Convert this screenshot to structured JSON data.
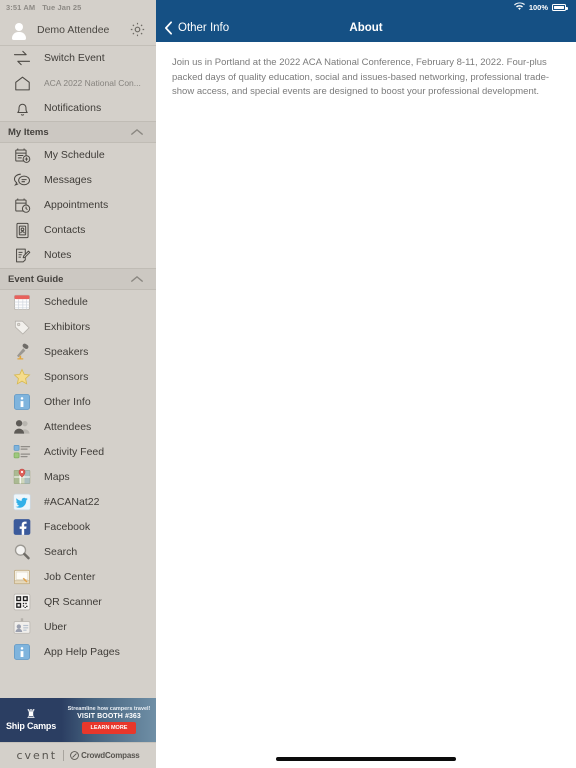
{
  "status_bar": {
    "time": "3:51 AM",
    "date": "Tue Jan 25",
    "battery_percent": "100%",
    "wifi_icon": "wifi-icon",
    "battery_icon": "battery-full-icon"
  },
  "sidebar": {
    "profile": {
      "name": "Demo Attendee",
      "avatar_icon": "person-avatar-icon",
      "settings_icon": "gear-icon"
    },
    "top_items": [
      {
        "label": "Switch Event",
        "icon": "switch-arrows-icon",
        "dim": false
      },
      {
        "label": "ACA 2022 National Con...",
        "icon": "home-outline-icon",
        "dim": true
      },
      {
        "label": "Notifications",
        "icon": "bell-outline-icon",
        "dim": false
      }
    ],
    "sections": [
      {
        "title": "My Items",
        "chevron_icon": "chevron-up-icon",
        "items": [
          {
            "label": "My Schedule",
            "icon": "calendar-plus-icon"
          },
          {
            "label": "Messages",
            "icon": "chat-bubbles-icon"
          },
          {
            "label": "Appointments",
            "icon": "calendar-clock-icon"
          },
          {
            "label": "Contacts",
            "icon": "contact-card-icon"
          },
          {
            "label": "Notes",
            "icon": "note-pencil-icon"
          }
        ]
      },
      {
        "title": "Event Guide",
        "chevron_icon": "chevron-up-icon",
        "items": [
          {
            "label": "Schedule",
            "icon": "calendar-icon"
          },
          {
            "label": "Exhibitors",
            "icon": "tag-icon"
          },
          {
            "label": "Speakers",
            "icon": "microphone-icon"
          },
          {
            "label": "Sponsors",
            "icon": "star-icon"
          },
          {
            "label": "Other Info",
            "icon": "info-icon"
          },
          {
            "label": "Attendees",
            "icon": "people-icon"
          },
          {
            "label": "Activity Feed",
            "icon": "activity-feed-icon"
          },
          {
            "label": "Maps",
            "icon": "map-pin-icon"
          },
          {
            "label": "#ACANat22",
            "icon": "twitter-icon"
          },
          {
            "label": "Facebook",
            "icon": "facebook-icon"
          },
          {
            "label": "Search",
            "icon": "magnifier-icon"
          },
          {
            "label": "Job Center",
            "icon": "briefcase-icon"
          },
          {
            "label": "QR Scanner",
            "icon": "qr-code-icon"
          },
          {
            "label": "Uber",
            "icon": "id-badge-icon"
          },
          {
            "label": "App Help Pages",
            "icon": "info-icon"
          }
        ]
      }
    ],
    "ad": {
      "brand": "Ship Camps",
      "brand_mark_icon": "camp-trunk-icon",
      "line1": "Streamline how campers travel!",
      "line2": "VISIT BOOTH #363",
      "cta": "LEARN MORE",
      "cta_color": "#e8372b"
    },
    "footer": {
      "cvent": "cvent",
      "crowdcompass": "CrowdCompass",
      "crowdcompass_icon": "crowdcompass-logo-icon"
    }
  },
  "main": {
    "nav": {
      "back_label": "Other Info",
      "back_icon": "chevron-left-icon",
      "title": "About"
    },
    "about_text": "Join us in Portland at the 2022 ACA National Conference, February 8-11, 2022.  Four-plus packed days of quality education, social and issues-based networking, professional trade-show access, and special events are designed to boost your professional development."
  },
  "colors": {
    "nav_blue": "#155084",
    "sidebar_bg": "#d4d0ca",
    "section_bg": "#ccc8c2",
    "accent_red": "#e8372b"
  }
}
